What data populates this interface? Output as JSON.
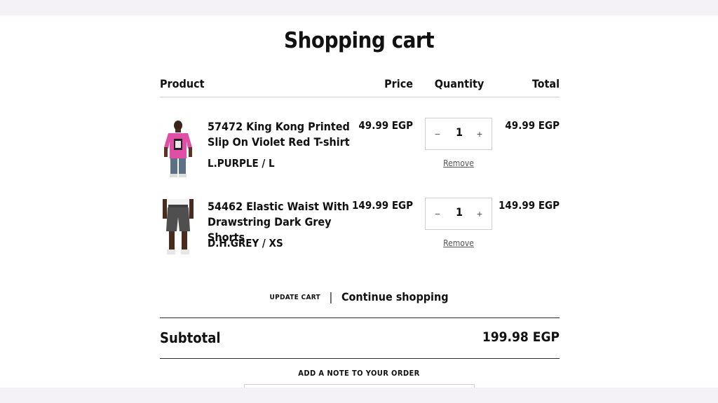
{
  "page": {
    "title": "Shopping cart"
  },
  "table": {
    "headers": {
      "product": "Product",
      "price": "Price",
      "quantity": "Quantity",
      "total": "Total"
    },
    "items": [
      {
        "name": "57472 King Kong Printed Slip On Violet Red T-shirt",
        "variant": "L.PURPLE / L",
        "price": "49.99 EGP",
        "quantity": "1",
        "total": "49.99 EGP",
        "minus": "−",
        "plus": "+",
        "remove": "Remove",
        "image": "pink-tshirt-model"
      },
      {
        "name": "54462 Elastic Waist With Drawstring Dark Grey Shorts",
        "variant": "D.H.GREY / XS",
        "price": "149.99 EGP",
        "quantity": "1",
        "total": "149.99 EGP",
        "minus": "−",
        "plus": "+",
        "remove": "Remove",
        "image": "grey-shorts-model"
      }
    ]
  },
  "actions": {
    "update_cart": "UPDATE CART",
    "separator": "|",
    "continue_shopping": "Continue shopping"
  },
  "summary": {
    "subtotal_label": "Subtotal",
    "subtotal_value": "199.98 EGP"
  },
  "note": {
    "label": "ADD A NOTE TO YOUR ORDER",
    "value": ""
  },
  "colors": {
    "text": "#111111",
    "muted": "#555555",
    "border": "#cfcfcf",
    "page_band": "#f5f2f7",
    "shirt": "#e04fa6"
  }
}
